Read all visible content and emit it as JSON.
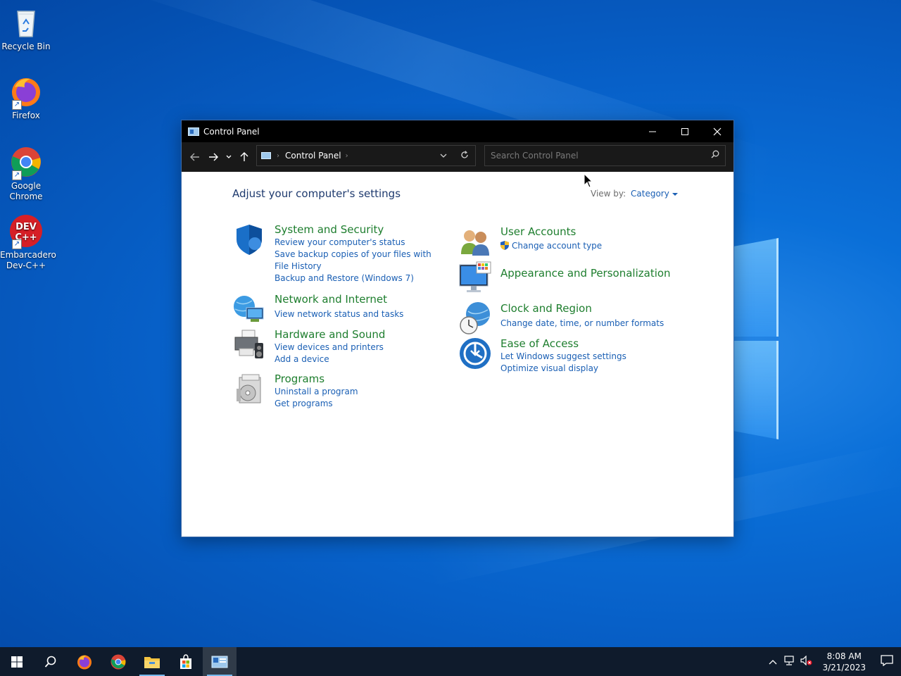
{
  "desktop": {
    "icons": [
      {
        "label": "Recycle Bin"
      },
      {
        "label": "Firefox"
      },
      {
        "label": "Google Chrome"
      },
      {
        "label": "Embarcadero Dev-C++"
      }
    ]
  },
  "window": {
    "title": "Control Panel",
    "address": {
      "crumb": "Control Panel"
    },
    "search": {
      "placeholder": "Search Control Panel"
    },
    "heading": "Adjust your computer's settings",
    "view_by_label": "View by:",
    "view_by_value": "Category",
    "categories_left": [
      {
        "title": "System and Security",
        "icon": "shield-icon",
        "links": [
          "Review your computer's status",
          "Save backup copies of your files with File History",
          "Backup and Restore (Windows 7)"
        ]
      },
      {
        "title": "Network and Internet",
        "icon": "network-icon",
        "links": [
          "View network status and tasks"
        ]
      },
      {
        "title": "Hardware and Sound",
        "icon": "printer-icon",
        "links": [
          "View devices and printers",
          "Add a device"
        ]
      },
      {
        "title": "Programs",
        "icon": "programs-icon",
        "links": [
          "Uninstall a program",
          "Get programs"
        ]
      }
    ],
    "categories_right": [
      {
        "title": "User Accounts",
        "icon": "users-icon",
        "links": [
          "Change account type"
        ]
      },
      {
        "title": "Appearance and Personalization",
        "icon": "monitor-icon",
        "links": []
      },
      {
        "title": "Clock and Region",
        "icon": "clock-globe-icon",
        "links": [
          "Change date, time, or number formats"
        ]
      },
      {
        "title": "Ease of Access",
        "icon": "ease-of-access-icon",
        "links": [
          "Let Windows suggest settings",
          "Optimize visual display"
        ]
      }
    ]
  },
  "taskbar": {
    "clock": {
      "time": "8:08 AM",
      "date": "3/21/2023"
    }
  },
  "colors": {
    "accent": "#1a5fb4",
    "category_title": "#1e7e2e",
    "titlebar": "#000000",
    "taskbar": "#0f1b2c"
  }
}
